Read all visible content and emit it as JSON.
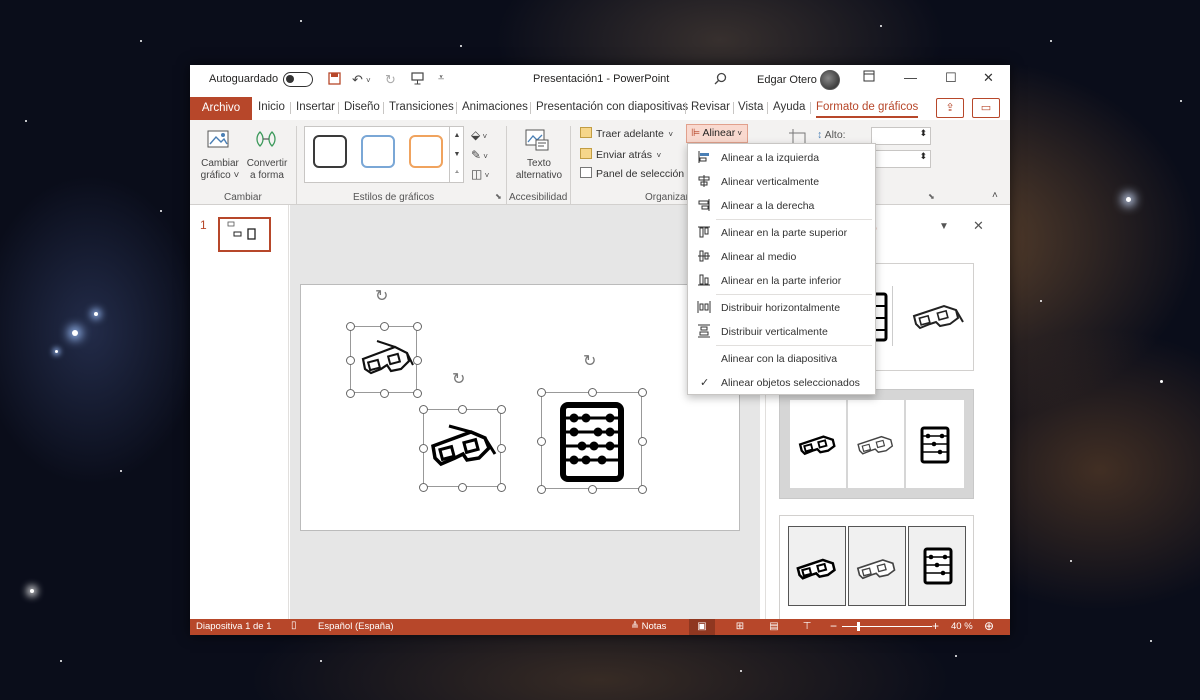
{
  "titlebar": {
    "autosave_label": "Autoguardado",
    "document_title": "Presentación1  -  PowerPoint",
    "user_name": "Edgar Otero"
  },
  "tabs": {
    "file": "Archivo",
    "items": [
      "Inicio",
      "Insertar",
      "Diseño",
      "Transiciones",
      "Animaciones",
      "Presentación con diapositivas",
      "Revisar",
      "Vista",
      "Ayuda"
    ],
    "active": "Formato de gráficos"
  },
  "ribbon": {
    "change_graphic": "Cambiar gráfico ˅",
    "convert_shape": "Convertir a forma",
    "group_change": "Cambiar",
    "group_styles": "Estilos de gráficos",
    "alt_text": "Texto alternativo",
    "group_accessibility": "Accesibilidad",
    "bring_forward": "Traer adelante",
    "send_backward": "Enviar atrás",
    "selection_pane": "Panel de selección",
    "align": "Alinear",
    "group_arrange": "Organizar",
    "height_label": "Alto:",
    "style_colors": [
      "#3a3a3a",
      "#7aa7d6",
      "#f0a35e"
    ]
  },
  "align_menu": {
    "items": [
      {
        "label": "Alinear a la izquierda",
        "icon": "align-left-icon"
      },
      {
        "label": "Alinear verticalmente",
        "icon": "align-center-icon"
      },
      {
        "label": "Alinear a la derecha",
        "icon": "align-right-icon"
      },
      {
        "label": "Alinear en la parte superior",
        "icon": "align-top-icon"
      },
      {
        "label": "Alinear al medio",
        "icon": "align-middle-icon"
      },
      {
        "label": "Alinear en la parte inferior",
        "icon": "align-bottom-icon"
      },
      {
        "label": "Distribuir horizontalmente",
        "icon": "distribute-horizontal-icon"
      },
      {
        "label": "Distribuir verticalmente",
        "icon": "distribute-vertical-icon"
      },
      {
        "label": "Alinear con la diapositiva",
        "icon": ""
      },
      {
        "label": "Alinear objetos seleccionados",
        "icon": "checkmark-icon",
        "checked": true
      }
    ]
  },
  "slides": {
    "number": "1"
  },
  "design_pane": {
    "title_fragment": "ño"
  },
  "statusbar": {
    "slide_info": "Diapositiva 1 de 1",
    "language": "Español (España)",
    "notes": "Notas",
    "zoom": "40 %"
  },
  "colors": {
    "accent": "#b7472a",
    "ribbon_bg": "#f3f2f1",
    "canvas_bg": "#e6e6e6"
  }
}
